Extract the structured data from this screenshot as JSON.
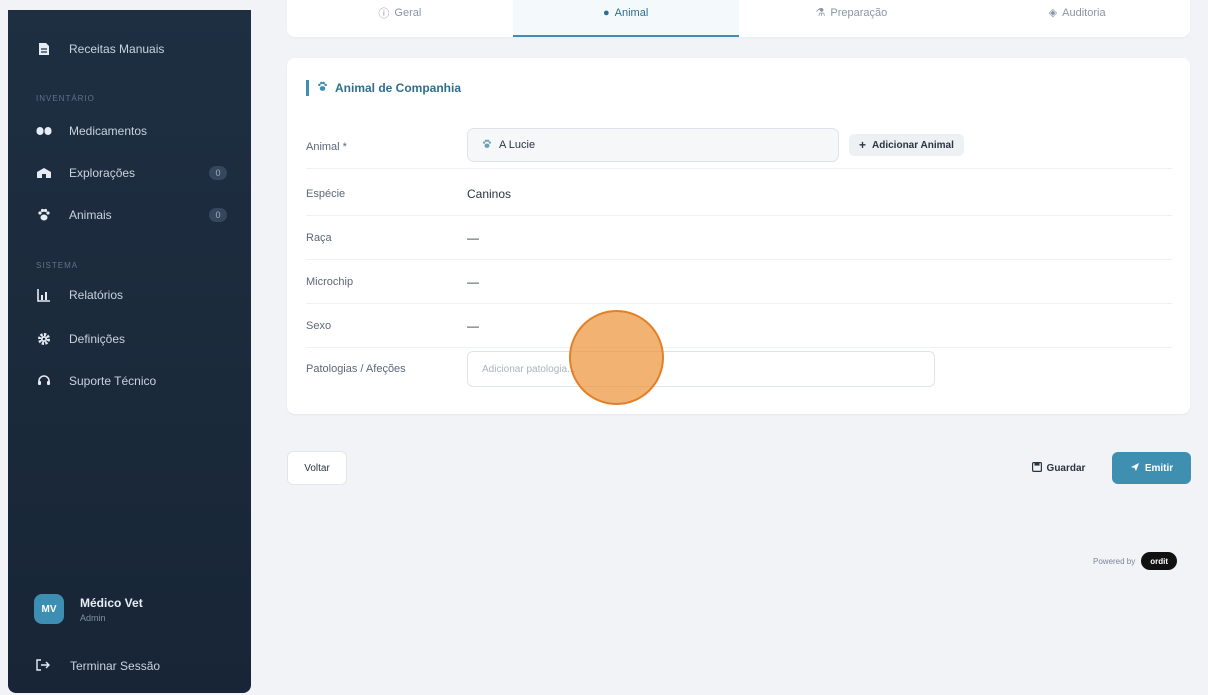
{
  "sidebar": {
    "top_item": {
      "label": "Receitas Manuais",
      "icon": "document-icon"
    },
    "section_inventory": "Inventário",
    "inventory_items": [
      {
        "label": "Medicamentos",
        "icon": "pills-icon",
        "badge": ""
      },
      {
        "label": "Explorações",
        "icon": "barn-icon",
        "badge": "0"
      },
      {
        "label": "Animais",
        "icon": "paw-icon",
        "badge": "0"
      }
    ],
    "section_system": "Sistema",
    "system_items": [
      {
        "label": "Relatórios",
        "icon": "chart-icon"
      },
      {
        "label": "Definições",
        "icon": "gear-icon"
      },
      {
        "label": "Suporte Técnico",
        "icon": "headset-icon"
      }
    ],
    "user": {
      "initials": "MV",
      "name": "Médico Vet",
      "role": "Admin"
    },
    "logout_label": "Terminar Sessão"
  },
  "tabs": [
    {
      "label": "Geral",
      "icon": "info-icon"
    },
    {
      "label": "Animal",
      "icon": "paw-icon",
      "active": true
    },
    {
      "label": "Preparação",
      "icon": "flask-icon"
    },
    {
      "label": "Auditoria",
      "icon": "shield-icon"
    }
  ],
  "card": {
    "title": "Animal de Companhia",
    "fields": {
      "animal_label": "Animal *",
      "animal_value": "A Lucie",
      "add_animal_label": "Adicionar Animal",
      "especie_label": "Espécie",
      "especie_value": "Caninos",
      "raca_label": "Raça",
      "raca_value": "—",
      "microchip_label": "Microchip",
      "microchip_value": "—",
      "sexo_label": "Sexo",
      "sexo_value": "—",
      "patologias_label": "Patologias / Afeções",
      "patologias_placeholder": "Adicionar patologia..."
    }
  },
  "actions": {
    "voltar_label": "Voltar",
    "guardar_label": "Guardar",
    "emitir_label": "Emitir"
  },
  "footer": {
    "powered_by": "Powered by",
    "brand": "ordit"
  },
  "colors": {
    "accent": "#3f8fb0",
    "sidebar_bg": "#1e2f42",
    "click_indicator": "#ec943c"
  }
}
